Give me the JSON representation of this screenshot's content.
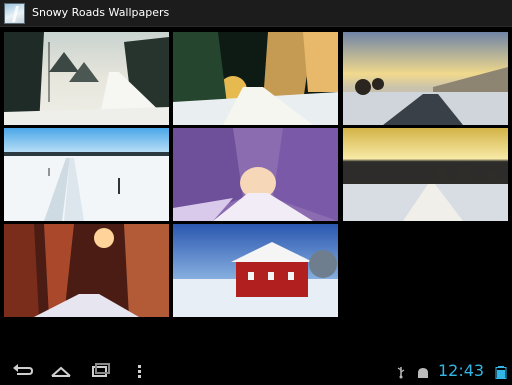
{
  "app": {
    "title": "Snowy Roads Wallpapers",
    "icon": "snow-road-app-icon"
  },
  "gallery": {
    "items": [
      {
        "name": "wallpaper-misty-forest-road"
      },
      {
        "name": "wallpaper-night-snow-trees"
      },
      {
        "name": "wallpaper-sunset-road"
      },
      {
        "name": "wallpaper-snow-field-tracks"
      },
      {
        "name": "wallpaper-purple-tree-tunnel"
      },
      {
        "name": "wallpaper-golden-sunrise-road"
      },
      {
        "name": "wallpaper-orange-sun-forest"
      },
      {
        "name": "wallpaper-red-house-snow"
      }
    ]
  },
  "navigation": {
    "back": "back-icon",
    "home": "home-icon",
    "recents": "recent-apps-icon"
  },
  "status": {
    "time": "12:43",
    "usb": "usb-icon",
    "android": "android-icon",
    "battery": "battery-icon"
  }
}
